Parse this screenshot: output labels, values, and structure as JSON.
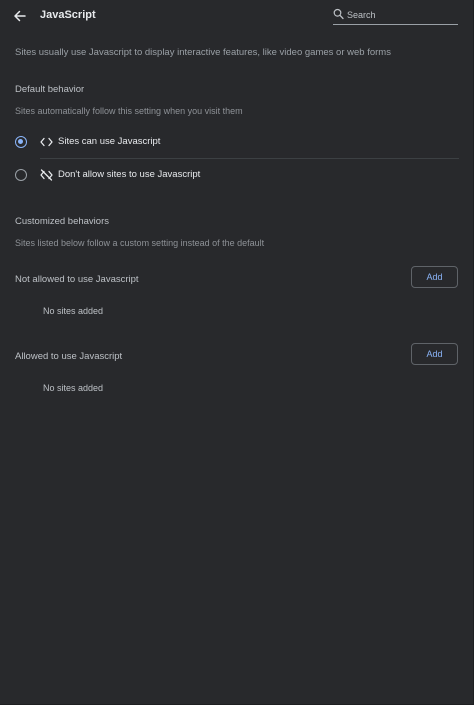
{
  "header": {
    "title": "JavaScript",
    "search_placeholder": "Search"
  },
  "description": "Sites usually use Javascript to display interactive features, like video games or web forms",
  "default_behavior": {
    "title": "Default behavior",
    "subtitle": "Sites automatically follow this setting when you visit them",
    "options": [
      {
        "label": "Sites can use Javascript",
        "icon": "code-icon",
        "selected": true
      },
      {
        "label": "Don't allow sites to use Javascript",
        "icon": "code-off-icon",
        "selected": false
      }
    ]
  },
  "customized": {
    "title": "Customized behaviors",
    "subtitle": "Sites listed below follow a custom setting instead of the default",
    "not_allowed": {
      "label": "Not allowed to use Javascript",
      "button": "Add",
      "empty": "No sites added"
    },
    "allowed": {
      "label": "Allowed to use Javascript",
      "button": "Add",
      "empty": "No sites added"
    }
  },
  "colors": {
    "background": "#28292c",
    "accent": "#8ab4f8",
    "text": "#e8eaed",
    "secondary_text": "#9aa0a6"
  }
}
